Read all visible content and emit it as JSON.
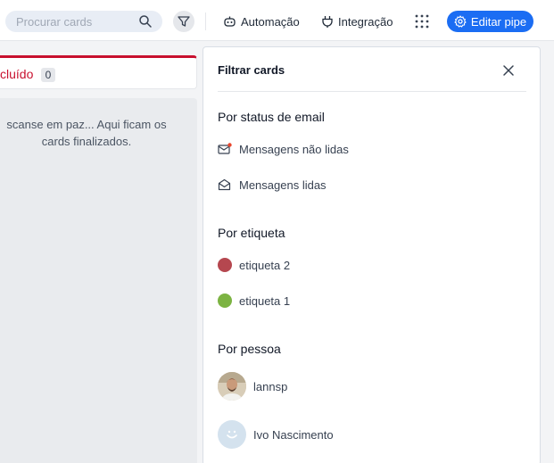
{
  "search": {
    "placeholder": "Procurar cards"
  },
  "toolbar": {
    "automation_label": "Automação",
    "integration_label": "Integração",
    "edit_pipe_label": "Editar pipe"
  },
  "column": {
    "title": "cluído",
    "count": "0",
    "empty_line1": "scanse em paz... Aqui ficam os",
    "empty_line2": "cards finalizados."
  },
  "filter_panel": {
    "title": "Filtrar cards",
    "email_section": {
      "title": "Por status de email",
      "items": [
        {
          "label": "Mensagens não lidas",
          "icon": "mail-unread-icon"
        },
        {
          "label": "Mensagens lidas",
          "icon": "mail-open-icon"
        }
      ]
    },
    "label_section": {
      "title": "Por etiqueta",
      "items": [
        {
          "label": "etiqueta 2",
          "color": "#b5474f"
        },
        {
          "label": "etiqueta 1",
          "color": "#7cb342"
        }
      ]
    },
    "person_section": {
      "title": "Por pessoa",
      "items": [
        {
          "name": "lannsp",
          "avatar": "photo"
        },
        {
          "name": "Ivo Nascimento",
          "avatar": "smiley-placeholder"
        }
      ]
    }
  },
  "colors": {
    "accent": "#1b6df3",
    "done_column": "#c8102e"
  }
}
